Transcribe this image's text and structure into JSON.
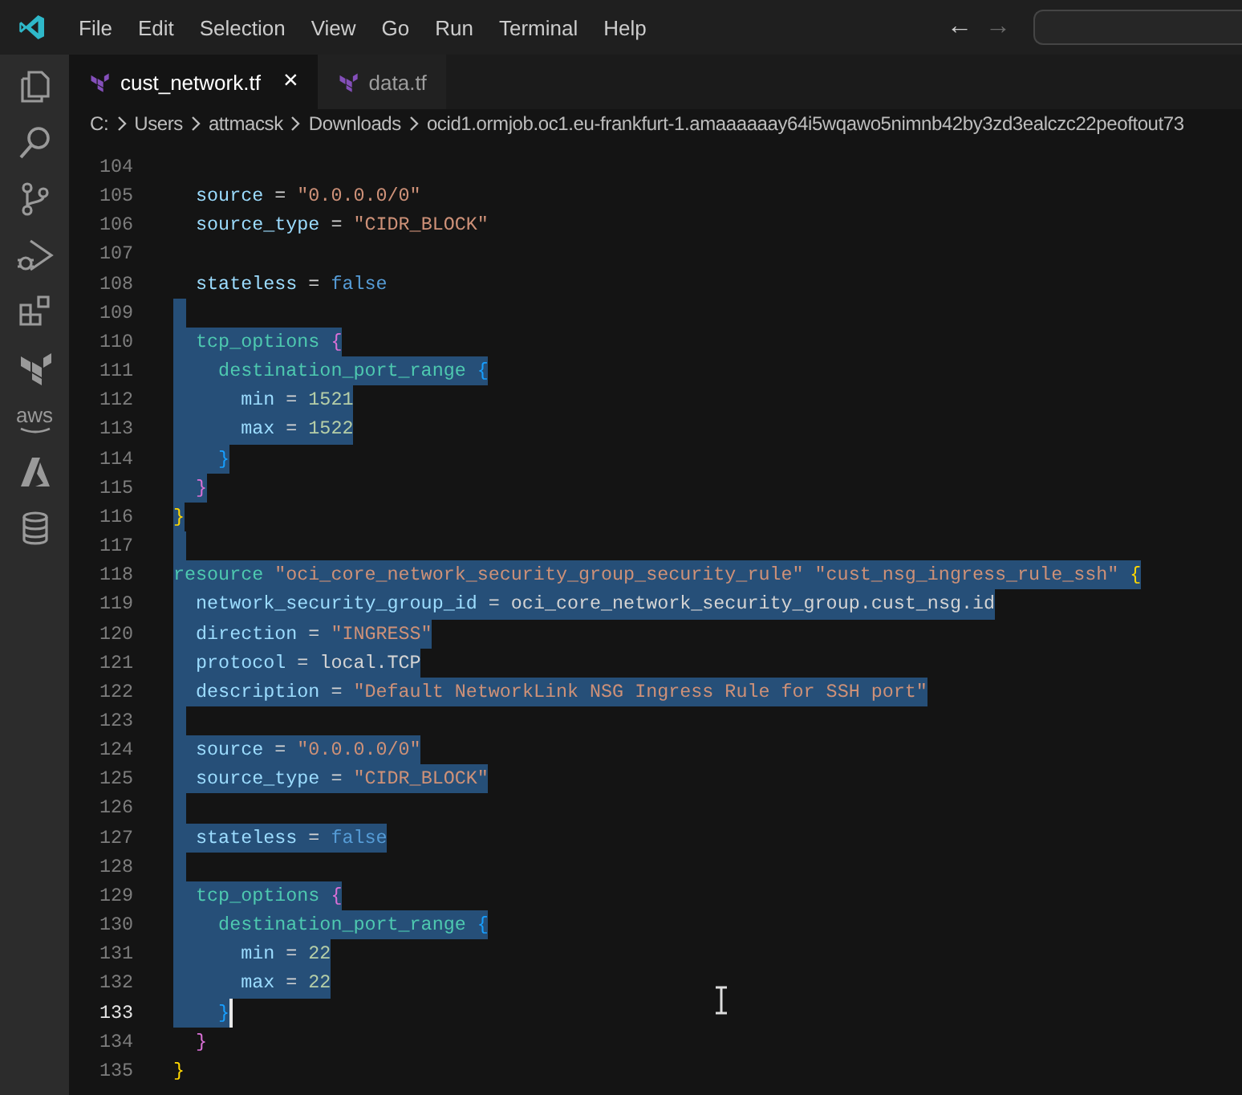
{
  "menu": [
    "File",
    "Edit",
    "Selection",
    "View",
    "Go",
    "Run",
    "Terminal",
    "Help"
  ],
  "nav": [
    {
      "glyph": "←",
      "disabled": false
    },
    {
      "glyph": "→",
      "disabled": true
    }
  ],
  "activity_bar": [
    {
      "kind": "explorer"
    },
    {
      "kind": "search"
    },
    {
      "kind": "source-control"
    },
    {
      "kind": "run-debug"
    },
    {
      "kind": "extensions"
    },
    {
      "kind": "terraform"
    },
    {
      "kind": "aws",
      "label": "aws"
    },
    {
      "kind": "azure"
    },
    {
      "kind": "database"
    }
  ],
  "tabs": [
    {
      "label": "cust_network.tf",
      "selected": true,
      "close": "×"
    },
    {
      "label": "data.tf",
      "selected": false
    }
  ],
  "breadcrumb": [
    "C:",
    "Users",
    "attmacsk",
    "Downloads",
    "ocid1.ormjob.oc1.eu-frankfurt-1.amaaaaaay64i5wqawo5nimnb42by3zd3ealczc22peoftout73"
  ],
  "lines": [
    {
      "number": "104",
      "selected": false,
      "current": false
    },
    {
      "number": "105",
      "selected": false,
      "current": false,
      "tokens": [
        {
          "kind": "key",
          "text": "  source"
        },
        {
          "kind": "op",
          "text": " = "
        },
        {
          "kind": "string",
          "text": "\"0.0.0.0/0\""
        }
      ]
    },
    {
      "number": "106",
      "selected": false,
      "current": false,
      "tokens": [
        {
          "kind": "key",
          "text": "  source_type"
        },
        {
          "kind": "op",
          "text": " = "
        },
        {
          "kind": "string",
          "text": "\"CIDR_BLOCK\""
        }
      ]
    },
    {
      "number": "107",
      "selected": false,
      "current": false
    },
    {
      "number": "108",
      "selected": false,
      "current": false,
      "tokens": [
        {
          "kind": "key",
          "text": "  stateless"
        },
        {
          "kind": "op",
          "text": " = "
        },
        {
          "kind": "bool",
          "text": "false"
        }
      ]
    },
    {
      "number": "109",
      "selected": true,
      "current": false
    },
    {
      "number": "110",
      "selected": true,
      "current": false,
      "tokens": [
        {
          "kind": "block",
          "text": "  tcp_options"
        },
        {
          "kind": "brace2",
          "text": " {"
        }
      ]
    },
    {
      "number": "111",
      "selected": true,
      "current": false,
      "tokens": [
        {
          "kind": "block",
          "text": "    destination_port_range"
        },
        {
          "kind": "brace3",
          "text": " {"
        }
      ]
    },
    {
      "number": "112",
      "selected": true,
      "current": false,
      "tokens": [
        {
          "kind": "key",
          "text": "      min"
        },
        {
          "kind": "op",
          "text": " = "
        },
        {
          "kind": "number",
          "text": "1521"
        }
      ]
    },
    {
      "number": "113",
      "selected": true,
      "current": false,
      "tokens": [
        {
          "kind": "key",
          "text": "      max"
        },
        {
          "kind": "op",
          "text": " = "
        },
        {
          "kind": "number",
          "text": "1522"
        }
      ]
    },
    {
      "number": "114",
      "selected": true,
      "current": false,
      "tokens": [
        {
          "kind": "brace3",
          "text": "    }"
        }
      ]
    },
    {
      "number": "115",
      "selected": true,
      "current": false,
      "tokens": [
        {
          "kind": "brace2",
          "text": "  }"
        }
      ]
    },
    {
      "number": "116",
      "selected": true,
      "current": false,
      "tokens": [
        {
          "kind": "brace1",
          "text": "}"
        }
      ]
    },
    {
      "number": "117",
      "selected": true,
      "current": false
    },
    {
      "number": "118",
      "selected": true,
      "current": false,
      "tokens": [
        {
          "kind": "keyword",
          "text": "resource"
        },
        {
          "kind": "string",
          "text": " \"oci_core_network_security_group_security_rule\""
        },
        {
          "kind": "string",
          "text": " \"cust_nsg_ingress_rule_ssh\""
        },
        {
          "kind": "brace1",
          "text": " {"
        }
      ]
    },
    {
      "number": "119",
      "selected": true,
      "current": false,
      "tokens": [
        {
          "kind": "key",
          "text": "  network_security_group_id"
        },
        {
          "kind": "op",
          "text": " = "
        },
        {
          "kind": "plain",
          "text": "oci_core_network_security_group.cust_nsg.id"
        }
      ]
    },
    {
      "number": "120",
      "selected": true,
      "current": false,
      "tokens": [
        {
          "kind": "key",
          "text": "  direction"
        },
        {
          "kind": "op",
          "text": " = "
        },
        {
          "kind": "string",
          "text": "\"INGRESS\""
        }
      ]
    },
    {
      "number": "121",
      "selected": true,
      "current": false,
      "tokens": [
        {
          "kind": "key",
          "text": "  protocol"
        },
        {
          "kind": "op",
          "text": " = "
        },
        {
          "kind": "plain",
          "text": "local.TCP"
        }
      ]
    },
    {
      "number": "122",
      "selected": true,
      "current": false,
      "tokens": [
        {
          "kind": "key",
          "text": "  description"
        },
        {
          "kind": "op",
          "text": " = "
        },
        {
          "kind": "string",
          "text": "\"Default NetworkLink NSG Ingress Rule for SSH port\""
        }
      ]
    },
    {
      "number": "123",
      "selected": true,
      "current": false
    },
    {
      "number": "124",
      "selected": true,
      "current": false,
      "tokens": [
        {
          "kind": "key",
          "text": "  source"
        },
        {
          "kind": "op",
          "text": " = "
        },
        {
          "kind": "string",
          "text": "\"0.0.0.0/0\""
        }
      ]
    },
    {
      "number": "125",
      "selected": true,
      "current": false,
      "tokens": [
        {
          "kind": "key",
          "text": "  source_type"
        },
        {
          "kind": "op",
          "text": " = "
        },
        {
          "kind": "string",
          "text": "\"CIDR_BLOCK\""
        }
      ]
    },
    {
      "number": "126",
      "selected": true,
      "current": false
    },
    {
      "number": "127",
      "selected": true,
      "current": false,
      "tokens": [
        {
          "kind": "key",
          "text": "  stateless"
        },
        {
          "kind": "op",
          "text": " = "
        },
        {
          "kind": "bool",
          "text": "false"
        }
      ]
    },
    {
      "number": "128",
      "selected": true,
      "current": false
    },
    {
      "number": "129",
      "selected": true,
      "current": false,
      "tokens": [
        {
          "kind": "block",
          "text": "  tcp_options"
        },
        {
          "kind": "brace2",
          "text": " {"
        }
      ]
    },
    {
      "number": "130",
      "selected": true,
      "current": false,
      "tokens": [
        {
          "kind": "block",
          "text": "    destination_port_range"
        },
        {
          "kind": "brace3",
          "text": " {"
        }
      ]
    },
    {
      "number": "131",
      "selected": true,
      "current": false,
      "tokens": [
        {
          "kind": "key",
          "text": "      min"
        },
        {
          "kind": "op",
          "text": " = "
        },
        {
          "kind": "number",
          "text": "22"
        }
      ]
    },
    {
      "number": "132",
      "selected": true,
      "current": false,
      "tokens": [
        {
          "kind": "key",
          "text": "      max"
        },
        {
          "kind": "op",
          "text": " = "
        },
        {
          "kind": "number",
          "text": "22"
        }
      ]
    },
    {
      "number": "133",
      "selected": true,
      "current": true,
      "tokens": [
        {
          "kind": "brace3",
          "text": "    }"
        }
      ]
    },
    {
      "number": "134",
      "selected": false,
      "current": false,
      "tokens": [
        {
          "kind": "brace2",
          "text": "  }"
        }
      ]
    },
    {
      "number": "135",
      "selected": false,
      "current": false,
      "tokens": [
        {
          "kind": "brace1",
          "text": "}"
        }
      ]
    }
  ]
}
